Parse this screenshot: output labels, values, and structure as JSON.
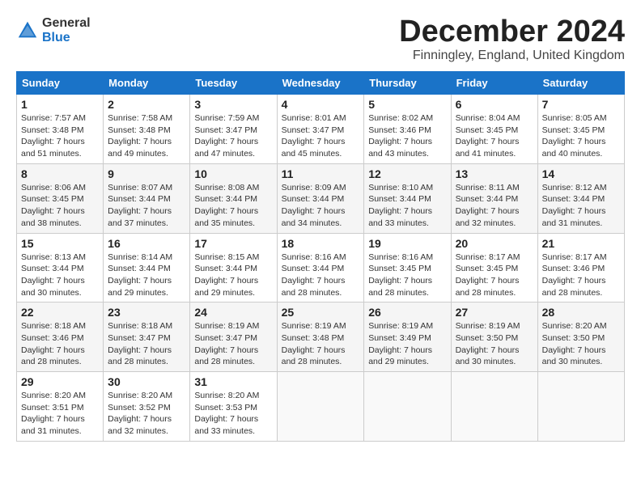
{
  "header": {
    "logo_general": "General",
    "logo_blue": "Blue",
    "month_title": "December 2024",
    "subtitle": "Finningley, England, United Kingdom"
  },
  "days_of_week": [
    "Sunday",
    "Monday",
    "Tuesday",
    "Wednesday",
    "Thursday",
    "Friday",
    "Saturday"
  ],
  "weeks": [
    [
      {
        "day": "1",
        "sunrise": "Sunrise: 7:57 AM",
        "sunset": "Sunset: 3:48 PM",
        "daylight": "Daylight: 7 hours and 51 minutes."
      },
      {
        "day": "2",
        "sunrise": "Sunrise: 7:58 AM",
        "sunset": "Sunset: 3:48 PM",
        "daylight": "Daylight: 7 hours and 49 minutes."
      },
      {
        "day": "3",
        "sunrise": "Sunrise: 7:59 AM",
        "sunset": "Sunset: 3:47 PM",
        "daylight": "Daylight: 7 hours and 47 minutes."
      },
      {
        "day": "4",
        "sunrise": "Sunrise: 8:01 AM",
        "sunset": "Sunset: 3:47 PM",
        "daylight": "Daylight: 7 hours and 45 minutes."
      },
      {
        "day": "5",
        "sunrise": "Sunrise: 8:02 AM",
        "sunset": "Sunset: 3:46 PM",
        "daylight": "Daylight: 7 hours and 43 minutes."
      },
      {
        "day": "6",
        "sunrise": "Sunrise: 8:04 AM",
        "sunset": "Sunset: 3:45 PM",
        "daylight": "Daylight: 7 hours and 41 minutes."
      },
      {
        "day": "7",
        "sunrise": "Sunrise: 8:05 AM",
        "sunset": "Sunset: 3:45 PM",
        "daylight": "Daylight: 7 hours and 40 minutes."
      }
    ],
    [
      {
        "day": "8",
        "sunrise": "Sunrise: 8:06 AM",
        "sunset": "Sunset: 3:45 PM",
        "daylight": "Daylight: 7 hours and 38 minutes."
      },
      {
        "day": "9",
        "sunrise": "Sunrise: 8:07 AM",
        "sunset": "Sunset: 3:44 PM",
        "daylight": "Daylight: 7 hours and 37 minutes."
      },
      {
        "day": "10",
        "sunrise": "Sunrise: 8:08 AM",
        "sunset": "Sunset: 3:44 PM",
        "daylight": "Daylight: 7 hours and 35 minutes."
      },
      {
        "day": "11",
        "sunrise": "Sunrise: 8:09 AM",
        "sunset": "Sunset: 3:44 PM",
        "daylight": "Daylight: 7 hours and 34 minutes."
      },
      {
        "day": "12",
        "sunrise": "Sunrise: 8:10 AM",
        "sunset": "Sunset: 3:44 PM",
        "daylight": "Daylight: 7 hours and 33 minutes."
      },
      {
        "day": "13",
        "sunrise": "Sunrise: 8:11 AM",
        "sunset": "Sunset: 3:44 PM",
        "daylight": "Daylight: 7 hours and 32 minutes."
      },
      {
        "day": "14",
        "sunrise": "Sunrise: 8:12 AM",
        "sunset": "Sunset: 3:44 PM",
        "daylight": "Daylight: 7 hours and 31 minutes."
      }
    ],
    [
      {
        "day": "15",
        "sunrise": "Sunrise: 8:13 AM",
        "sunset": "Sunset: 3:44 PM",
        "daylight": "Daylight: 7 hours and 30 minutes."
      },
      {
        "day": "16",
        "sunrise": "Sunrise: 8:14 AM",
        "sunset": "Sunset: 3:44 PM",
        "daylight": "Daylight: 7 hours and 29 minutes."
      },
      {
        "day": "17",
        "sunrise": "Sunrise: 8:15 AM",
        "sunset": "Sunset: 3:44 PM",
        "daylight": "Daylight: 7 hours and 29 minutes."
      },
      {
        "day": "18",
        "sunrise": "Sunrise: 8:16 AM",
        "sunset": "Sunset: 3:44 PM",
        "daylight": "Daylight: 7 hours and 28 minutes."
      },
      {
        "day": "19",
        "sunrise": "Sunrise: 8:16 AM",
        "sunset": "Sunset: 3:45 PM",
        "daylight": "Daylight: 7 hours and 28 minutes."
      },
      {
        "day": "20",
        "sunrise": "Sunrise: 8:17 AM",
        "sunset": "Sunset: 3:45 PM",
        "daylight": "Daylight: 7 hours and 28 minutes."
      },
      {
        "day": "21",
        "sunrise": "Sunrise: 8:17 AM",
        "sunset": "Sunset: 3:46 PM",
        "daylight": "Daylight: 7 hours and 28 minutes."
      }
    ],
    [
      {
        "day": "22",
        "sunrise": "Sunrise: 8:18 AM",
        "sunset": "Sunset: 3:46 PM",
        "daylight": "Daylight: 7 hours and 28 minutes."
      },
      {
        "day": "23",
        "sunrise": "Sunrise: 8:18 AM",
        "sunset": "Sunset: 3:47 PM",
        "daylight": "Daylight: 7 hours and 28 minutes."
      },
      {
        "day": "24",
        "sunrise": "Sunrise: 8:19 AM",
        "sunset": "Sunset: 3:47 PM",
        "daylight": "Daylight: 7 hours and 28 minutes."
      },
      {
        "day": "25",
        "sunrise": "Sunrise: 8:19 AM",
        "sunset": "Sunset: 3:48 PM",
        "daylight": "Daylight: 7 hours and 28 minutes."
      },
      {
        "day": "26",
        "sunrise": "Sunrise: 8:19 AM",
        "sunset": "Sunset: 3:49 PM",
        "daylight": "Daylight: 7 hours and 29 minutes."
      },
      {
        "day": "27",
        "sunrise": "Sunrise: 8:19 AM",
        "sunset": "Sunset: 3:50 PM",
        "daylight": "Daylight: 7 hours and 30 minutes."
      },
      {
        "day": "28",
        "sunrise": "Sunrise: 8:20 AM",
        "sunset": "Sunset: 3:50 PM",
        "daylight": "Daylight: 7 hours and 30 minutes."
      }
    ],
    [
      {
        "day": "29",
        "sunrise": "Sunrise: 8:20 AM",
        "sunset": "Sunset: 3:51 PM",
        "daylight": "Daylight: 7 hours and 31 minutes."
      },
      {
        "day": "30",
        "sunrise": "Sunrise: 8:20 AM",
        "sunset": "Sunset: 3:52 PM",
        "daylight": "Daylight: 7 hours and 32 minutes."
      },
      {
        "day": "31",
        "sunrise": "Sunrise: 8:20 AM",
        "sunset": "Sunset: 3:53 PM",
        "daylight": "Daylight: 7 hours and 33 minutes."
      },
      null,
      null,
      null,
      null
    ]
  ]
}
